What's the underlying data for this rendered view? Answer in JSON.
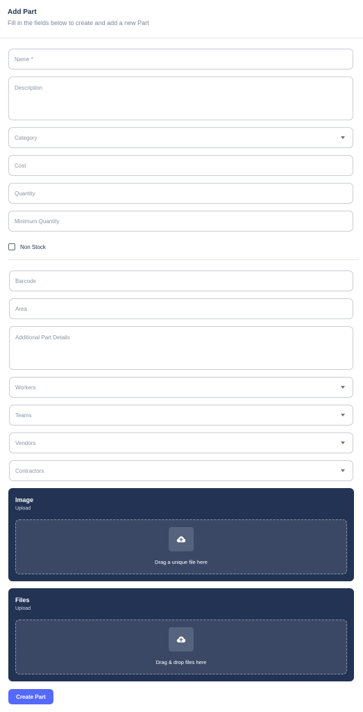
{
  "header": {
    "title": "Add Part",
    "subtitle": "Fill in the fields below to create and add a new Part"
  },
  "fields": {
    "name": {
      "placeholder": "Name *"
    },
    "description": {
      "placeholder": "Description"
    },
    "category": {
      "placeholder": "Category"
    },
    "cost": {
      "placeholder": "Cost"
    },
    "quantity": {
      "placeholder": "Quantity"
    },
    "minimum_quantity": {
      "placeholder": "Minimum Quantity"
    },
    "non_stock": {
      "label": "Non Stock",
      "checked": false
    },
    "barcode": {
      "placeholder": "Barcode"
    },
    "area": {
      "placeholder": "Area"
    },
    "additional_details": {
      "placeholder": "Additional Part Details"
    },
    "workers": {
      "placeholder": "Workers"
    },
    "teams": {
      "placeholder": "Teams"
    },
    "vendors": {
      "placeholder": "Vendors"
    },
    "contractors": {
      "placeholder": "Contractors"
    }
  },
  "image_upload": {
    "title": "Image",
    "subtitle": "Upload",
    "drop_text": "Drag a unique file here",
    "icon": "cloud-upload-icon"
  },
  "files_upload": {
    "title": "Files",
    "subtitle": "Upload",
    "drop_text": "Drag & drop files here",
    "icon": "cloud-upload-icon"
  },
  "submit": {
    "label": "Create Part"
  },
  "colors": {
    "primary": "#5569ff",
    "card_bg": "#223354",
    "dropzone_bg": "#3a4865",
    "border": "#c9cdd4"
  }
}
